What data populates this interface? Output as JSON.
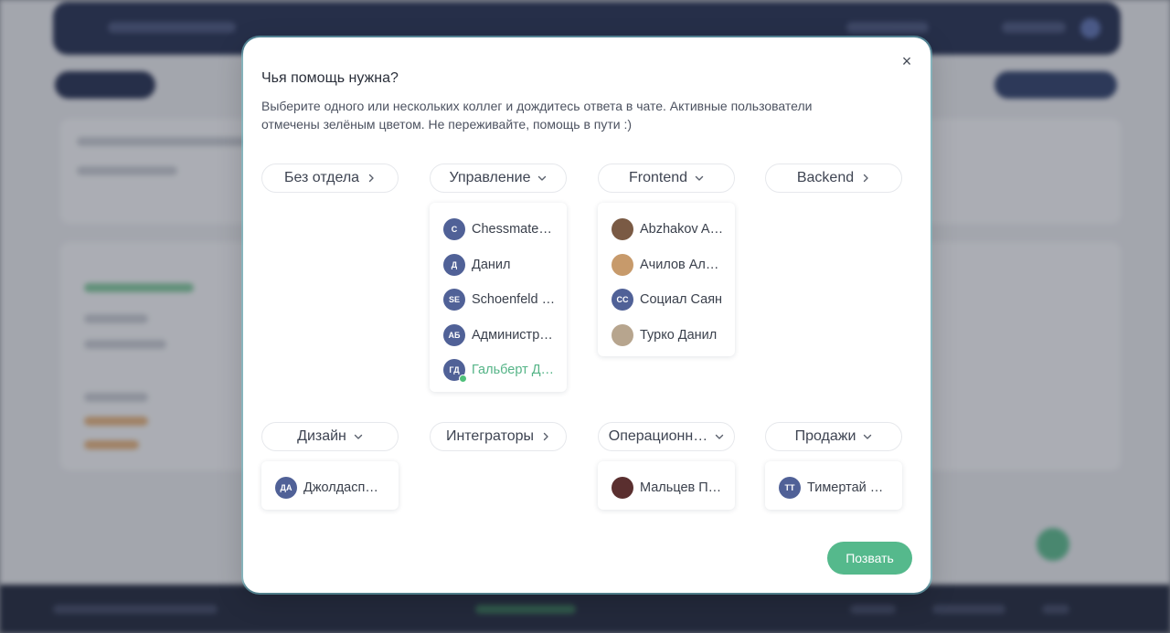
{
  "modal": {
    "title": "Чья помощь нужна?",
    "description": "Выберите одного или нескольких коллег и дождитесь ответа в чате. Активные пользователи отмечены зелёным цветом. Не переживайте, помощь в пути :)",
    "close_icon": "close-icon",
    "close_glyph": "×",
    "call_button": "Позвать"
  },
  "colors": {
    "accent": "#55b98c",
    "avatar": "#506197",
    "online": "#4fc07a"
  },
  "departments": [
    {
      "name": "Без отдела",
      "expanded": false,
      "members": []
    },
    {
      "name": "Управление",
      "expanded": true,
      "members": [
        {
          "initials": "C",
          "name": "Chessmate…",
          "online": false
        },
        {
          "initials": "Д",
          "name": "Данил",
          "online": false
        },
        {
          "initials": "SE",
          "name": "Schoenfeld …",
          "online": false
        },
        {
          "initials": "АБ",
          "name": "Администр…",
          "online": false
        },
        {
          "initials": "ГД",
          "name": "Гальберт Д…",
          "online": true
        }
      ]
    },
    {
      "name": "Frontend",
      "expanded": true,
      "members": [
        {
          "initials": "",
          "name": "Abzhakov A…",
          "online": false,
          "photo": true
        },
        {
          "initials": "",
          "name": "Ачилов Ал…",
          "online": false,
          "photo": true
        },
        {
          "initials": "СС",
          "name": "Социал Саян",
          "online": false
        },
        {
          "initials": "",
          "name": "Турко Данил",
          "online": false,
          "photo": true
        }
      ]
    },
    {
      "name": "Backend",
      "expanded": false,
      "members": []
    },
    {
      "name": "Дизайн",
      "expanded": true,
      "members": [
        {
          "initials": "ДА",
          "name": "Джолдасп…",
          "online": false
        }
      ]
    },
    {
      "name": "Интеграторы",
      "expanded": false,
      "members": []
    },
    {
      "name": "Операционн…",
      "expanded": true,
      "members": [
        {
          "initials": "",
          "name": "Мальцев П…",
          "online": false,
          "photo": true
        }
      ]
    },
    {
      "name": "Продажи",
      "expanded": true,
      "members": [
        {
          "initials": "ТТ",
          "name": "Тимертай Т…",
          "online": false
        }
      ]
    }
  ]
}
